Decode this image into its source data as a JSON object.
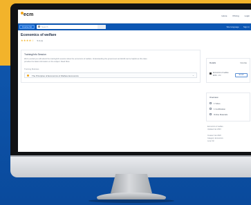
{
  "window": {
    "logo": "ecm"
  },
  "nav": {
    "links": [
      "Home",
      "Pricing",
      "Login"
    ]
  },
  "bar": {
    "browse_label": "Course list",
    "search_placeholder": "Search",
    "links": [
      "Site language",
      "Sign in"
    ]
  },
  "page": {
    "title": "Economics of welfare",
    "stars": "★★★★☆",
    "rating_text": "5.0 (1)"
  },
  "main_card": {
    "heading": "Training/Info Session",
    "lines": [
      "We're excited you will attend the training/info session about the economics of welfare. Understanding the government and ECM can be helpful as this class",
      "provides the latest information on the subject.  Read More"
    ],
    "sub": "Training Modules",
    "outline_label": "The Principles of Economics of Welfare Economics"
  },
  "side_card": {
    "title": "Details",
    "right": "Course",
    "lines": [
      "Economics of welfare",
      "ECM · 1 hr"
    ],
    "button": "Enroll"
  },
  "side_card2": {
    "title": "Overview",
    "items": [
      "1 Video",
      "1 Certification",
      "Online Materials"
    ]
  },
  "side_meta": [
    "Economics of welfare",
    "Updated Jan 2023",
    "Created: Jan 2020",
    "Category: Economics",
    "Level: All"
  ],
  "colors": {
    "accent": "#0d57b3",
    "background_top": "#f2b32b",
    "background_bottom": "#0b4fa3"
  }
}
